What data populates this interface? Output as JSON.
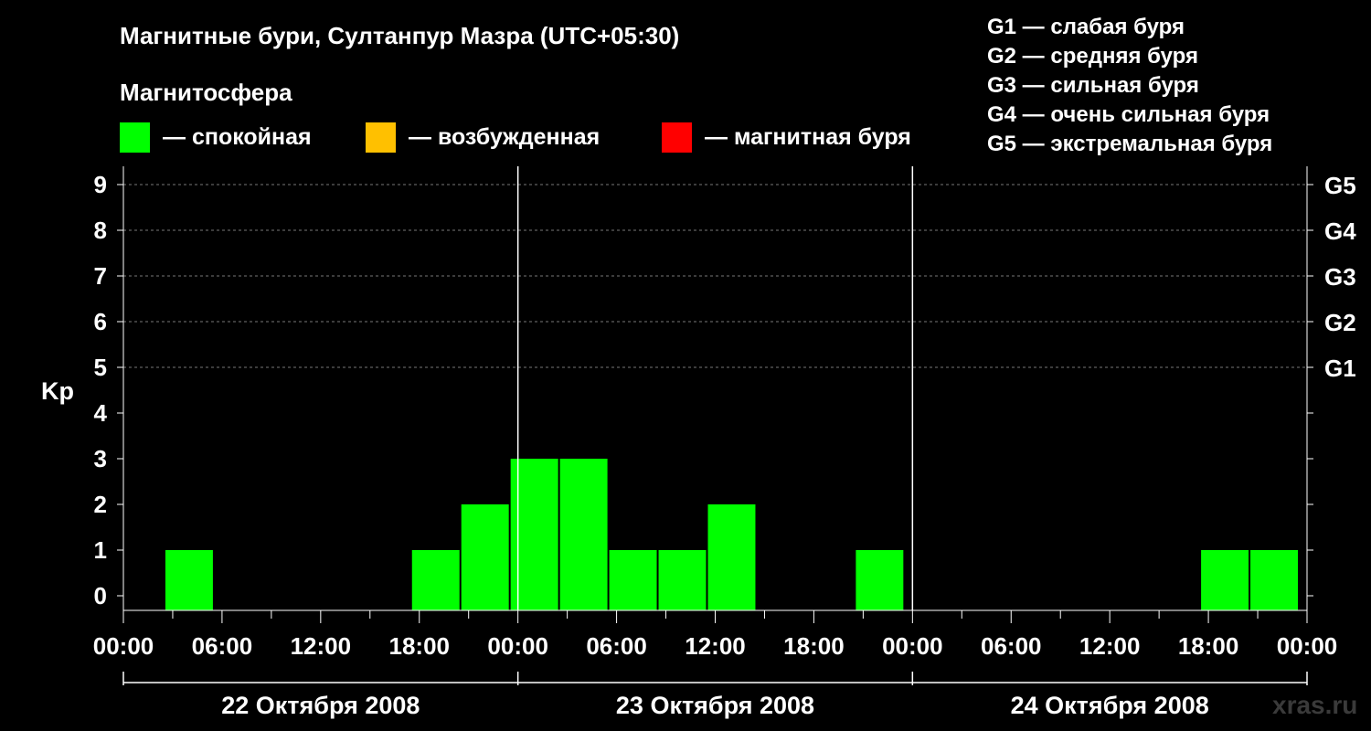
{
  "title": "Магнитные бури, Султанпур Мазра (UTC+05:30)",
  "subtitle": "Магнитосфера",
  "legend": [
    {
      "label": "— спокойная",
      "color": "#00ff00"
    },
    {
      "label": "— возбужденная",
      "color": "#ffc000"
    },
    {
      "label": "— магнитная буря",
      "color": "#ff0000"
    }
  ],
  "g_levels": [
    "G1 — слабая буря",
    "G2 — средняя буря",
    "G3 — сильная буря",
    "G4 — очень сильная буря",
    "G5 — экстремальная буря"
  ],
  "watermark": "xras.ru",
  "chart_data": {
    "type": "bar",
    "ylabel": "Kp",
    "ylim": [
      0,
      9
    ],
    "y_ticks": [
      "0",
      "1",
      "2",
      "3",
      "4",
      "5",
      "6",
      "7",
      "8",
      "9"
    ],
    "right_axis_labels": [
      {
        "kp": 5,
        "label": "G1"
      },
      {
        "kp": 6,
        "label": "G2"
      },
      {
        "kp": 7,
        "label": "G3"
      },
      {
        "kp": 8,
        "label": "G4"
      },
      {
        "kp": 9,
        "label": "G5"
      }
    ],
    "x_tick_labels": [
      "00:00",
      "06:00",
      "12:00",
      "18:00",
      "00:00",
      "06:00",
      "12:00",
      "18:00",
      "00:00",
      "06:00",
      "12:00",
      "18:00",
      "00:00"
    ],
    "days": [
      "22 Октября 2008",
      "23 Октября 2008",
      "24 Октября 2008"
    ],
    "bar_interval_hours": 3,
    "bars": [
      {
        "start_hour": 2.5,
        "kp": 1,
        "level": "calm"
      },
      {
        "start_hour": 17.5,
        "kp": 1,
        "level": "calm"
      },
      {
        "start_hour": 20.5,
        "kp": 2,
        "level": "calm"
      },
      {
        "start_hour": 23.5,
        "kp": 3,
        "level": "calm"
      },
      {
        "start_hour": 26.5,
        "kp": 3,
        "level": "calm"
      },
      {
        "start_hour": 29.5,
        "kp": 1,
        "level": "calm"
      },
      {
        "start_hour": 32.5,
        "kp": 1,
        "level": "calm"
      },
      {
        "start_hour": 35.5,
        "kp": 2,
        "level": "calm"
      },
      {
        "start_hour": 44.5,
        "kp": 1,
        "level": "calm"
      },
      {
        "start_hour": 65.5,
        "kp": 1,
        "level": "calm"
      },
      {
        "start_hour": 68.5,
        "kp": 1,
        "level": "calm"
      }
    ],
    "level_colors": {
      "calm": "#00ff00",
      "active": "#ffc000",
      "storm": "#ff0000"
    },
    "gridlines_at": [
      5,
      6,
      7,
      8,
      9
    ]
  }
}
